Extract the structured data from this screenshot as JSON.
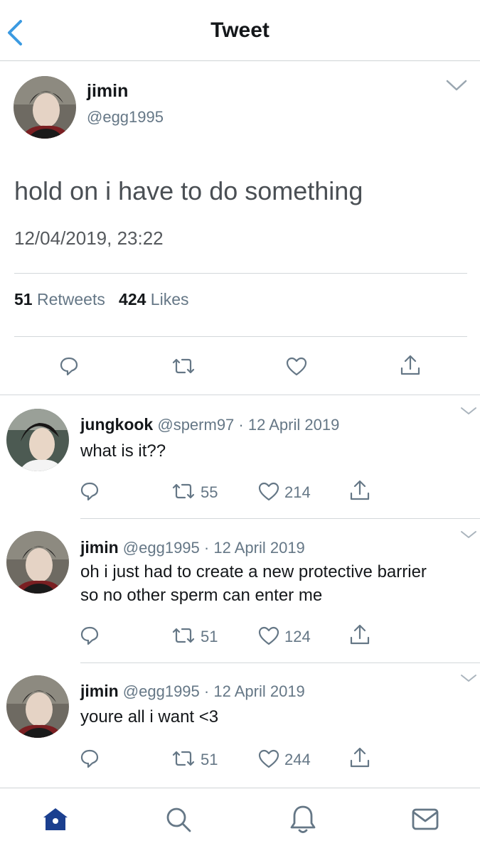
{
  "nav": {
    "title": "Tweet",
    "back_icon": "chevron-left-icon"
  },
  "tweet": {
    "author_name": "jimin",
    "author_handle": "@egg1995",
    "text": "hold on i have to do something",
    "timestamp": "12/04/2019, 23:22",
    "retweets_count": "51",
    "retweets_label": "Retweets",
    "likes_count": "424",
    "likes_label": "Likes"
  },
  "replies": [
    {
      "name": "jungkook",
      "handle": "@sperm97",
      "date": "12 April 2019",
      "text": "what is it??",
      "retweets": "55",
      "likes": "214"
    },
    {
      "name": "jimin",
      "handle": "@egg1995",
      "date": "12 April 2019",
      "text": "oh i just had to create a new protective barrier so no other sperm can enter me",
      "retweets": "51",
      "likes": "124"
    },
    {
      "name": "jimin",
      "handle": "@egg1995",
      "date": "12 April 2019",
      "text": "youre all i want <3",
      "retweets": "51",
      "likes": "244"
    }
  ],
  "separator": "·",
  "tabbar": {
    "items": [
      "home-icon",
      "search-icon",
      "notifications-icon",
      "messages-icon"
    ],
    "active": "home-icon"
  },
  "colors": {
    "accent": "#1da1f2",
    "muted": "#657786",
    "home_active": "#1b3f8f"
  }
}
